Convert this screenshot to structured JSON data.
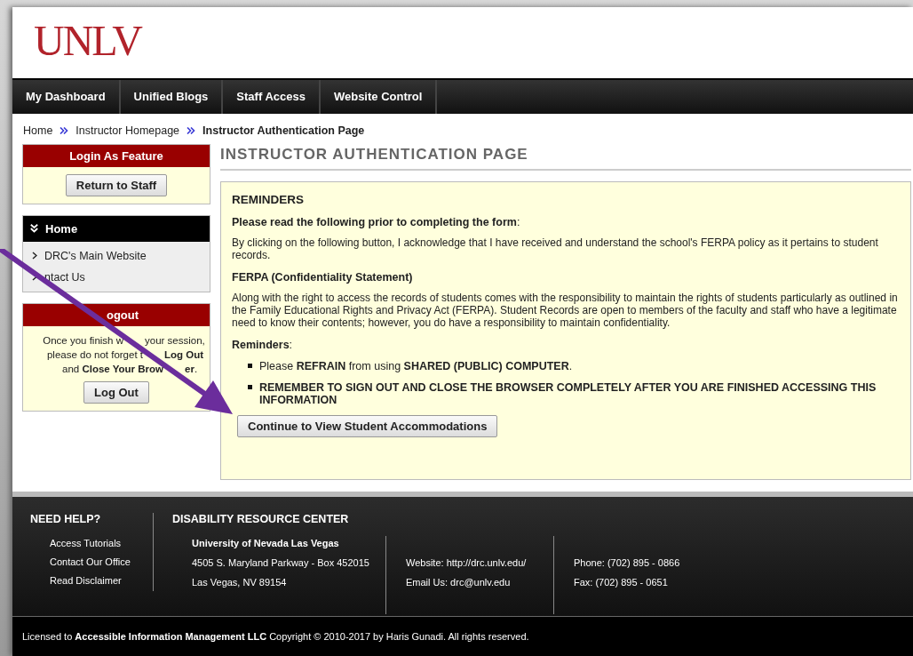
{
  "logo": "UNLV",
  "nav": [
    {
      "label": "My Dashboard"
    },
    {
      "label": "Unified Blogs"
    },
    {
      "label": "Staff Access"
    },
    {
      "label": "Website Control"
    }
  ],
  "breadcrumb": [
    {
      "label": "Home",
      "kind": "link"
    },
    {
      "label": "Instructor Homepage",
      "kind": "link"
    },
    {
      "label": "Instructor Authentication Page",
      "kind": "current"
    }
  ],
  "sidebar": {
    "login_box": {
      "title": "Login As Feature",
      "button": "Return to Staff"
    },
    "menu": {
      "title": "Home",
      "items": [
        {
          "label": "DRC's Main Website"
        },
        {
          "label": "ntact Us"
        }
      ]
    },
    "logout_box": {
      "title": "ogout",
      "message_lines": [
        [
          "Once you finish w",
          "your session,"
        ],
        [
          "please do not forget t",
          "**Log Out**"
        ],
        [
          "and **Close Your Brow**",
          "**er**."
        ]
      ],
      "button": "Log Out"
    }
  },
  "main": {
    "heading": "INSTRUCTOR AUTHENTICATION PAGE",
    "panel": {
      "title": "REMINDERS",
      "subtitle": "**Please read the following prior to completing the form**:",
      "intro": "By clicking on the following button, I acknowledge that I have received and understand the school's FERPA policy as it pertains to student records.",
      "section_title": "FERPA (Confidentiality Statement)",
      "statement": "Along with the right to access the records of students comes with the responsibility to maintain the rights of students particularly as outlined in the Family Educational Rights and Privacy Act (FERPA). Student Records are open to members of the faculty and staff who have a legitimate need to know their contents; however, you do have a responsibility to maintain confidentiality.",
      "reminders_title": "**Reminders**:",
      "bullets": [
        {
          "text": "Please **REFRAIN** from using **SHARED (PUBLIC) COMPUTER**.",
          "emphasis": false
        },
        {
          "text": "REMEMBER TO SIGN OUT AND CLOSE THE BROWSER COMPLETELY AFTER YOU ARE FINISHED ACCESSING THIS INFORMATION",
          "emphasis": true
        }
      ],
      "button": "Continue to View Student Accommodations"
    }
  },
  "footer": {
    "help": {
      "title": "NEED HELP?",
      "links": [
        "Access Tutorials",
        "Contact Our Office",
        "Read Disclaimer"
      ]
    },
    "drc": {
      "title": "DISABILITY RESOURCE CENTER",
      "columns": [
        [
          "**University of Nevada Las Vegas**",
          "4505 S. Maryland Parkway - Box 452015",
          "Las Vegas, NV 89154"
        ],
        [
          "Website: http://drc.unlv.edu/",
          "Email Us: drc@unlv.edu"
        ],
        [
          "Phone: (702) 895 - 0866",
          "Fax: (702) 895 - 0651"
        ]
      ]
    },
    "copyright": "Licensed to **Accessible Information Management LLC** Copyright © 2010-2017 by Haris Gunadi. All rights reserved."
  }
}
